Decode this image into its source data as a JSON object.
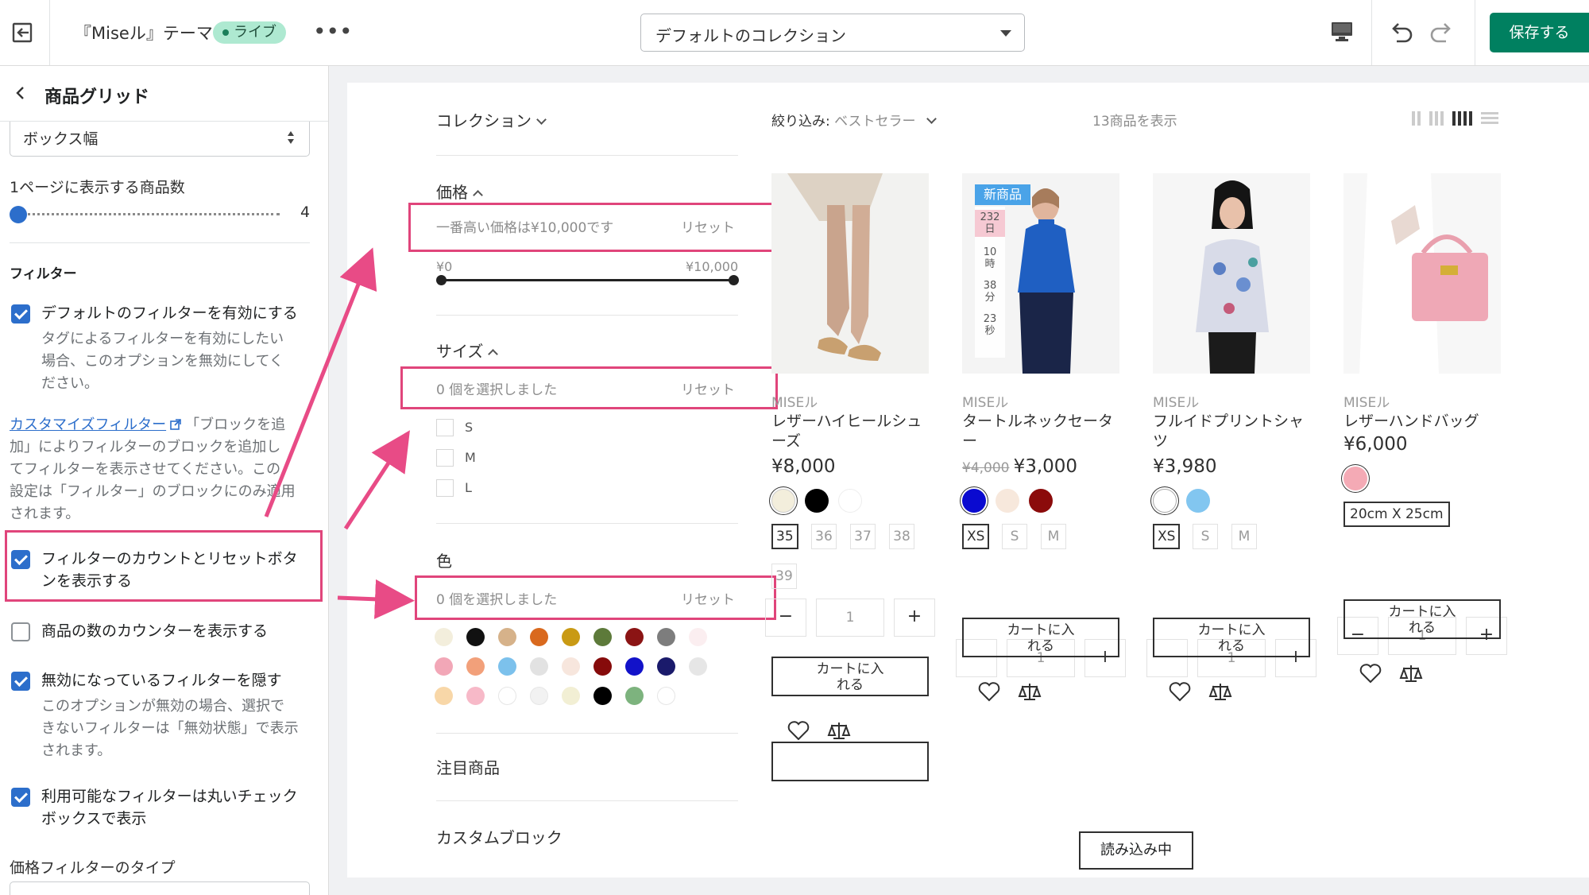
{
  "topbar": {
    "theme_name": "『Miseル』テーマ",
    "live_badge": "ライブ",
    "more": "•••",
    "collection_select": "デフォルトのコレクション",
    "save_label": "保存する"
  },
  "sidebar": {
    "title": "商品グリッド",
    "box_width_select": "ボックス幅",
    "products_per_page_label": "1ページに表示する商品数",
    "products_per_page_value": "4",
    "filter_section": "フィルター",
    "enable_default_filter": "デフォルトのフィルターを有効にする",
    "enable_default_filter_help": [
      "タグによるフィルターを有効にしたい",
      "場合、このオプションを無効にしてく",
      "ださい。"
    ],
    "customize_link": "カスタマイズフィルター",
    "customize_help": [
      "「ブロックを追",
      "加」によりフィルターのブロックを追加し",
      "てフィルターを表示させてください。この",
      "設定は「フィルター」のブロックにのみ適用",
      "されます。"
    ],
    "show_count_reset": [
      "フィルターのカウントとリセットボタ",
      "ンを表示する"
    ],
    "show_product_count": "商品の数のカウンターを表示する",
    "hide_disabled": "無効になっているフィルターを隠す",
    "hide_disabled_help": [
      "このオプションが無効の場合、選択で",
      "きないフィルターは「無効状態」で表示",
      "されます。"
    ],
    "round_checkbox": [
      "利用可能なフィルターは丸いチェック",
      "ボックスで表示"
    ],
    "price_filter_type": "価格フィルターのタイプ",
    "checkbox_states": {
      "enable_default_filter": true,
      "show_count_reset": true,
      "show_product_count": false,
      "hide_disabled": true,
      "round_checkbox": true
    }
  },
  "filters": {
    "collection": "コレクション",
    "price": "価格",
    "price_info": "一番高い価格は¥10,000です",
    "reset": "リセット",
    "price_min": "¥0",
    "price_max": "¥10,000",
    "size": "サイズ",
    "size_info": "0 個を選択しました",
    "sizes": [
      "S",
      "M",
      "L"
    ],
    "color": "色",
    "color_info": "0 個を選択しました",
    "colors": [
      "#f3eedc",
      "#111111",
      "#d6b28a",
      "#d9691e",
      "#c99a14",
      "#5d7a3a",
      "#8b1414",
      "#7d7d7d",
      "#fbeef0",
      "#f2a7b7",
      "#f2a07a",
      "#7cc1ec",
      "#e2e2e2",
      "#f7e6dd",
      "#860b0b",
      "#1212c9",
      "#1a1a6b",
      "#e6e6e6",
      "#f8d7a8",
      "#f7b9c8",
      "#ffffff",
      "#f2f2f2",
      "#f2efd4",
      "#000000",
      "#7db37e",
      "#ffffff"
    ],
    "featured": "注目商品",
    "custom_block": "カスタムブロック"
  },
  "toolbar": {
    "sort_label": "絞り込み:",
    "sort_value": "ベストセラー",
    "count": "13商品を表示"
  },
  "products": [
    {
      "brand": "MISEル",
      "name": [
        "レザーハイヒールシュ",
        "ーズ"
      ],
      "price": "¥8,000",
      "old_price": "",
      "swatches": [
        "#f3eedc",
        "#000000",
        "#ffffff"
      ],
      "selected_swatch": 0,
      "sizes": [
        "35",
        "36",
        "37",
        "38",
        "39"
      ],
      "selected_size": 0,
      "qty": "1",
      "cart": [
        "カートに入",
        "れる"
      ]
    },
    {
      "brand": "MISEル",
      "name": [
        "タートルネックセータ",
        "ー"
      ],
      "price": "¥3,000",
      "old_price": "¥4,000",
      "badge": "新商品",
      "countdown": [
        {
          "n": "232",
          "u": "日"
        },
        {
          "n": "10",
          "u": "時"
        },
        {
          "n": "38",
          "u": "分"
        },
        {
          "n": "23",
          "u": "秒"
        }
      ],
      "swatches": [
        "#0a0ad0",
        "#f7e8dc",
        "#8b0b0b"
      ],
      "selected_swatch": 0,
      "sizes": [
        "XS",
        "S",
        "M"
      ],
      "selected_size": 0,
      "qty": "1",
      "cart": [
        "カートに入",
        "れる"
      ]
    },
    {
      "brand": "MISEル",
      "name": [
        "フルイドプリントシャ",
        "ツ"
      ],
      "price": "¥3,980",
      "old_price": "",
      "swatches": [
        "#ffffff",
        "#82c6f0"
      ],
      "selected_swatch": 0,
      "sizes": [
        "XS",
        "S",
        "M"
      ],
      "selected_size": 0,
      "qty": "1",
      "cart": [
        "カートに入",
        "れる"
      ]
    },
    {
      "brand": "MISEル",
      "name": [
        "レザーハンドバッグ"
      ],
      "price": "¥6,000",
      "old_price": "",
      "swatches": [
        "#f4aab5"
      ],
      "selected_swatch": 0,
      "sizes": [
        "20cm X 25cm"
      ],
      "selected_size": 0,
      "qty": "1",
      "cart": [
        "カートに入",
        "れる"
      ]
    }
  ],
  "loading_button": "読み込み中",
  "accent": {
    "green": "#008060",
    "blue": "#2c6ecb",
    "highlight": "#e0457b"
  }
}
